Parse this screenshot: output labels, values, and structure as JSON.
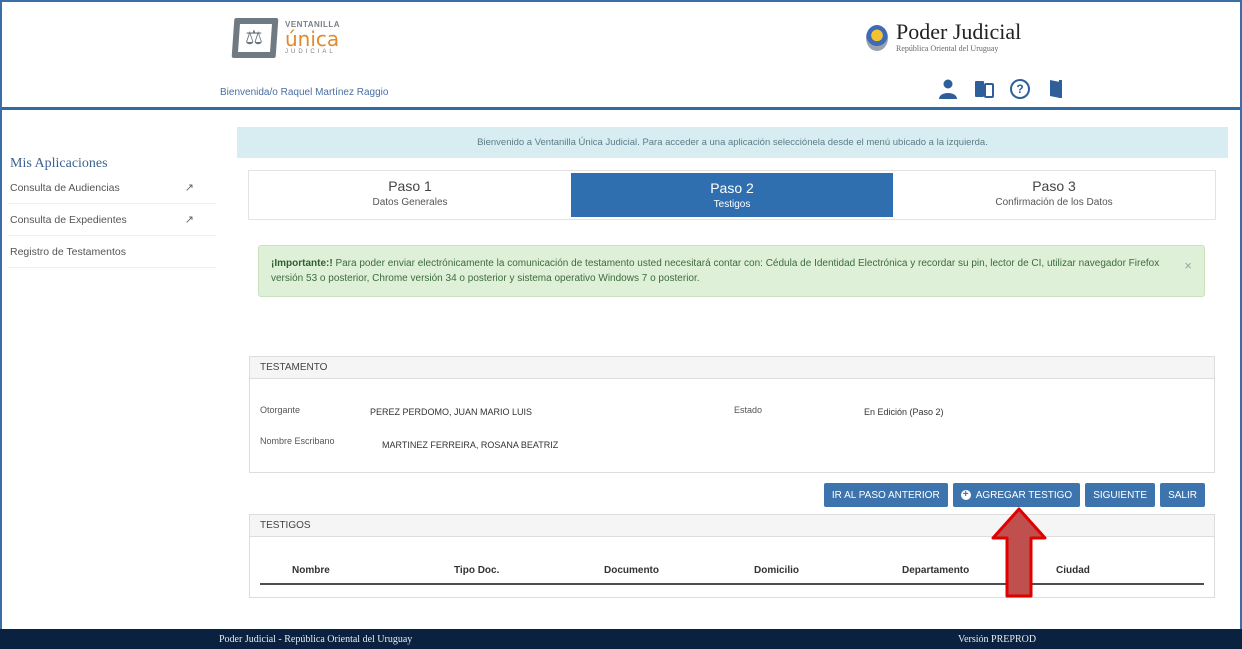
{
  "header": {
    "logo": {
      "top": "VENTANILLA",
      "main": "única",
      "bottom": "JUDICIAL"
    },
    "welcome_text": "Bienvenida/o Raquel Martínez Raggio",
    "brand_title": "Poder Judicial",
    "brand_subtitle": "República Oriental del Uruguay",
    "icons": [
      "user-icon",
      "switch-icon",
      "help-icon",
      "exit-icon"
    ],
    "help_glyph": "?"
  },
  "sidebar": {
    "title": "Mis Aplicaciones",
    "items": [
      {
        "label": "Consulta de Audiencias",
        "external": true
      },
      {
        "label": "Consulta de Expedientes",
        "external": true
      },
      {
        "label": "Registro de Testamentos",
        "external": false
      }
    ]
  },
  "info_bar": "Bienvenido a Ventanilla Única Judicial. Para acceder a una aplicación selecciónela desde el menú ubicado a la izquierda.",
  "steps": [
    {
      "title": "Paso 1",
      "subtitle": "Datos Generales",
      "active": false
    },
    {
      "title": "Paso 2",
      "subtitle": "Testigos",
      "active": true
    },
    {
      "title": "Paso 3",
      "subtitle": "Confirmación de los Datos",
      "active": false
    }
  ],
  "alert": {
    "strong": "¡Importante:!",
    "text": " Para poder enviar electrónicamente la comunicación de testamento usted necesitará contar con: Cédula de Identidad Electrónica y recordar su pin, lector de CI, utilizar navegador Firefox versión 53 o posterior, Chrome versión 34 o posterior y sistema operativo Windows 7 o posterior.",
    "close": "×"
  },
  "testamento": {
    "heading": "TESTAMENTO",
    "otorgante_label": "Otorgante",
    "otorgante_value": "PEREZ PERDOMO, JUAN MARIO LUIS",
    "estado_label": "Estado",
    "estado_value": "En Edición (Paso 2)",
    "escribano_label": "Nombre Escribano",
    "escribano_value": "MARTINEZ FERREIRA, ROSANA BEATRIZ"
  },
  "actions": {
    "prev": "IR AL PASO ANTERIOR",
    "add": "AGREGAR TESTIGO",
    "next": "SIGUIENTE",
    "exit": "SALIR",
    "add_glyph": "+"
  },
  "testigos": {
    "heading": "TESTIGOS",
    "columns": [
      "Nombre",
      "Tipo Doc.",
      "Documento",
      "Domicilio",
      "Departamento",
      "Ciudad"
    ]
  },
  "footer": {
    "left": "Poder Judicial - República Oriental del Uruguay",
    "right": "Versión PREPROD"
  },
  "colors": {
    "primary": "#2f6fb0",
    "footer": "#0b2140",
    "alert_bg": "#dff0d8",
    "info_bg": "#d8edf2",
    "arrow": "#c0504d"
  }
}
